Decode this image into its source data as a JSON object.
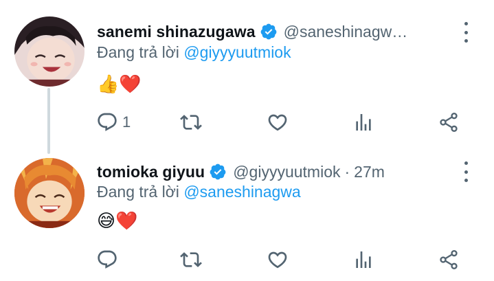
{
  "colors": {
    "accent": "#1d9bf0",
    "secondary_text": "#536471",
    "primary_text": "#0f1419",
    "thread_line": "#cfd9de"
  },
  "tweets": [
    {
      "author_name": "sanemi shinazugawa",
      "verified": true,
      "handle": "@saneshinagw…",
      "time": "",
      "reply_prefix": "Đang trả lời",
      "reply_to": "@giyyyuutmiok",
      "text": "👍❤️",
      "reply_count": "1",
      "avatar_icon": "anime-avatar-dark-hair"
    },
    {
      "author_name": "tomioka giyuu",
      "verified": true,
      "handle": "@giyyyuutmiok",
      "separator": "·",
      "time": "27m",
      "reply_prefix": "Đang trả lời",
      "reply_to": "@saneshinagwa",
      "text": "😅❤️",
      "reply_count": "",
      "avatar_icon": "anime-avatar-orange-hair"
    }
  ],
  "icons": [
    "verified-badge-icon",
    "more-icon",
    "reply-icon",
    "retweet-icon",
    "like-icon",
    "stats-icon",
    "share-icon"
  ]
}
